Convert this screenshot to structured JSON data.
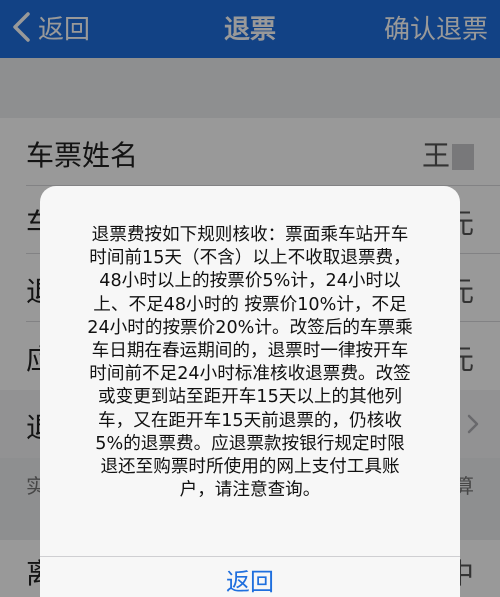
{
  "navbar": {
    "back_label": "返回",
    "title": "退票",
    "confirm_label": "确认退票"
  },
  "list": {
    "rows": [
      {
        "label": "车票姓名",
        "value": "王"
      },
      {
        "label": "车",
        "value": "元"
      },
      {
        "label": "退",
        "value": "元"
      },
      {
        "label": "应",
        "value": "元"
      },
      {
        "label": "退",
        "value": ""
      }
    ],
    "hint_left": "实",
    "hint_right": "算",
    "bottom_row": {
      "label": "离",
      "value": "中"
    }
  },
  "alert": {
    "message": "退票费按如下规则核收：票面乘车站开车\n时间前15天（不含）以上不收取退票费，\n48小时以上的按票价5%计，24小时以\n上、不足48小时的 按票价10%计，不足\n24小时的按票价20%计。改签后的车票乘\n车日期在春运期间的，退票时一律按开车\n时间前不足24小时标准核收退票费。改签\n或变更到站至距开车15天以上的其他列\n车，又在距开车15天前退票的，仍核收\n5%的退票费。应退票款按银行规定时限\n退还至购票时所使用的网上支付工具账\n户，请注意查询。",
    "button_label": "返回"
  },
  "colors": {
    "accent": "#1f6fde",
    "background": "#edeef1"
  }
}
